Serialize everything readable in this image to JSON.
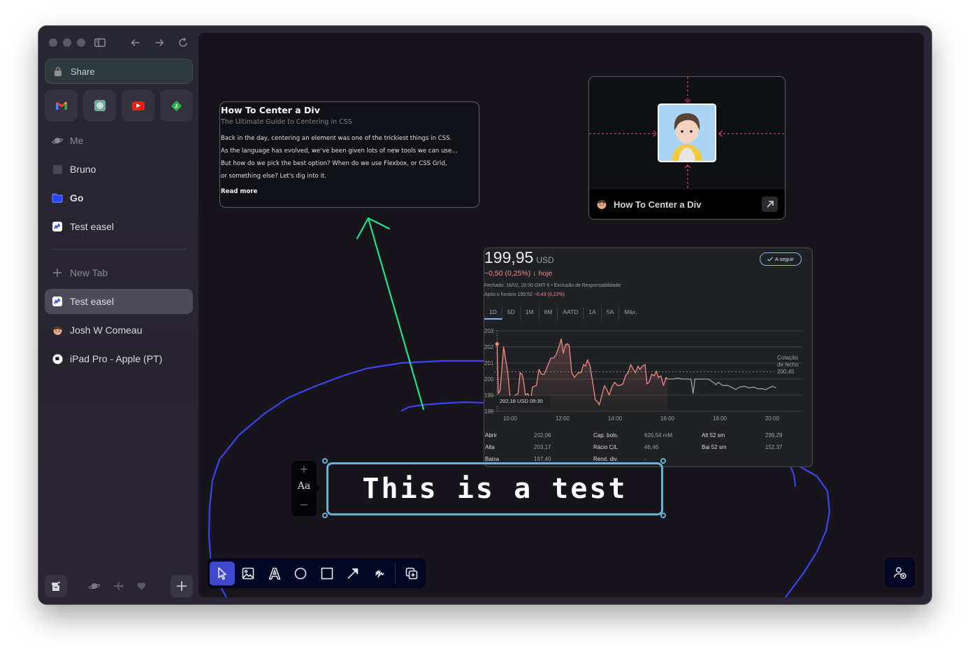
{
  "sidebar": {
    "share_label": "Share",
    "favorites": [
      {
        "name": "gmail-icon"
      },
      {
        "name": "chatgpt-icon"
      },
      {
        "name": "youtube-icon"
      },
      {
        "name": "feedly-icon"
      }
    ],
    "spaces_items": [
      {
        "label": "Me",
        "icon": "planet-icon"
      },
      {
        "label": "Bruno",
        "icon": "square-icon"
      },
      {
        "label": "Go",
        "icon": "folder-icon"
      },
      {
        "label": "Test easel",
        "icon": "easel-icon"
      }
    ],
    "new_tab_label": "New Tab",
    "tabs": [
      {
        "label": "Test easel",
        "icon": "easel-icon",
        "active": true
      },
      {
        "label": "Josh W Comeau",
        "icon": "avatar-icon",
        "active": false
      },
      {
        "label": "iPad Pro - Apple (PT)",
        "icon": "apple-icon",
        "active": false
      }
    ]
  },
  "article_card": {
    "title": "How To Center a Div",
    "subtitle": "The Ultimate Guide to Centering in CSS",
    "body_lines": [
      "Back in the day, centering an element was one of the trickiest things in CSS.",
      "As the language has evolved, we’ve been given lots of new tools we can use…",
      "But how do we pick the best option? When do we use Flexbox, or CSS Grid,",
      "or something else? Let's dig into it."
    ],
    "read_more": "Read more"
  },
  "image_card": {
    "title": "How To Center a Div"
  },
  "stock": {
    "price": "199,95",
    "currency": "USD",
    "change": "−0,50 (0,25%) ↓ hoje",
    "closed_line": "Fechado: 16/02, 20:00 GMT-5 • Exclusão de Responsabilidade",
    "after_hours_label": "Após o horário 199,52",
    "after_hours_change": "−0,43 (0,22%)",
    "follow_label": "A seguir",
    "ranges": [
      "1D",
      "5D",
      "1M",
      "6M",
      "AATD",
      "1A",
      "5A",
      "Máx."
    ],
    "active_range": "1D",
    "stats": [
      {
        "k": "Abrir",
        "v": "202,06"
      },
      {
        "k": "Alta",
        "v": "203,17"
      },
      {
        "k": "Baixa",
        "v": "197,40"
      },
      {
        "k": "Cap. bols.",
        "v": "626,54 mM"
      },
      {
        "k": "Rácio C/L",
        "v": "46,46"
      },
      {
        "k": "Rend. div.",
        "v": "-"
      },
      {
        "k": "Alt 52 sm",
        "v": "299,29"
      },
      {
        "k": "Bai 52 sm",
        "v": "152,37"
      }
    ]
  },
  "chart_data": {
    "type": "line",
    "title": "",
    "xlabel": "",
    "ylabel": "",
    "x_ticks": [
      "10:00",
      "12:00",
      "14:00",
      "16:00",
      "18:00",
      "20:00"
    ],
    "y_ticks": [
      198,
      199,
      200,
      201,
      202,
      203
    ],
    "ylim": [
      198,
      203
    ],
    "xlim_hours": [
      9.5,
      20.5
    ],
    "previous_close": 200.45,
    "previous_close_label": [
      "Cotação",
      "de fecho",
      "200,45"
    ],
    "hover_label": "202,18 USD  09:30",
    "series": [
      {
        "name": "regular",
        "color": "#f28b82",
        "points": [
          [
            9.5,
            202.18
          ],
          [
            9.55,
            199.1
          ],
          [
            9.62,
            199.3
          ],
          [
            9.75,
            202.0
          ],
          [
            9.9,
            200.5
          ],
          [
            10.0,
            198.8
          ],
          [
            10.1,
            198.7
          ],
          [
            10.2,
            199.0
          ],
          [
            10.3,
            199.1
          ],
          [
            10.38,
            200.4
          ],
          [
            10.45,
            200.3
          ],
          [
            10.5,
            200.0
          ],
          [
            10.58,
            199.0
          ],
          [
            10.68,
            199.1
          ],
          [
            10.78,
            198.6
          ],
          [
            10.85,
            199.5
          ],
          [
            11.0,
            199.6
          ],
          [
            11.1,
            200.6
          ],
          [
            11.2,
            200.3
          ],
          [
            11.3,
            200.3
          ],
          [
            11.45,
            200.9
          ],
          [
            11.55,
            201.3
          ],
          [
            11.65,
            201.3
          ],
          [
            11.75,
            201.5
          ],
          [
            11.88,
            202.1
          ],
          [
            11.95,
            202.5
          ],
          [
            12.03,
            201.6
          ],
          [
            12.1,
            202.1
          ],
          [
            12.18,
            202.2
          ],
          [
            12.25,
            202.1
          ],
          [
            12.35,
            200.4
          ],
          [
            12.45,
            200.1
          ],
          [
            12.6,
            200.4
          ],
          [
            12.7,
            200.4
          ],
          [
            12.8,
            200.9
          ],
          [
            12.88,
            200.8
          ],
          [
            12.95,
            201.2
          ],
          [
            13.05,
            200.8
          ],
          [
            13.15,
            199.8
          ],
          [
            13.25,
            198.7
          ],
          [
            13.33,
            198.6
          ],
          [
            13.4,
            198.4
          ],
          [
            13.5,
            199.0
          ],
          [
            13.6,
            199.6
          ],
          [
            13.7,
            199.3
          ],
          [
            13.78,
            199.0
          ],
          [
            13.88,
            199.5
          ],
          [
            13.98,
            199.8
          ],
          [
            14.1,
            199.6
          ],
          [
            14.2,
            199.6
          ],
          [
            14.3,
            199.7
          ],
          [
            14.4,
            200.2
          ],
          [
            14.5,
            200.4
          ],
          [
            14.6,
            200.9
          ],
          [
            14.7,
            200.6
          ],
          [
            14.78,
            200.4
          ],
          [
            14.88,
            200.8
          ],
          [
            14.95,
            200.6
          ],
          [
            15.05,
            200.8
          ],
          [
            15.15,
            200.9
          ],
          [
            15.22,
            199.7
          ],
          [
            15.3,
            199.8
          ],
          [
            15.4,
            200.3
          ],
          [
            15.5,
            200.2
          ],
          [
            15.58,
            200.5
          ],
          [
            15.65,
            200.1
          ],
          [
            15.75,
            200.2
          ],
          [
            15.85,
            199.6
          ],
          [
            15.95,
            200.1
          ],
          [
            16.0,
            200.0
          ]
        ]
      },
      {
        "name": "after-hours",
        "color": "#9aa0a6",
        "points": [
          [
            16.0,
            200.0
          ],
          [
            16.2,
            200.0
          ],
          [
            16.4,
            200.05
          ],
          [
            16.6,
            200.0
          ],
          [
            16.9,
            200.0
          ],
          [
            16.98,
            199.1
          ],
          [
            17.05,
            200.0
          ],
          [
            17.3,
            200.0
          ],
          [
            17.55,
            200.0
          ],
          [
            17.75,
            199.8
          ],
          [
            17.85,
            199.65
          ],
          [
            17.95,
            199.8
          ],
          [
            18.1,
            199.6
          ],
          [
            18.3,
            199.6
          ],
          [
            18.5,
            199.45
          ],
          [
            18.6,
            199.35
          ],
          [
            18.75,
            199.5
          ],
          [
            18.95,
            199.55
          ],
          [
            19.1,
            199.45
          ],
          [
            19.3,
            199.5
          ],
          [
            19.45,
            199.4
          ],
          [
            19.6,
            199.4
          ],
          [
            19.75,
            199.35
          ],
          [
            19.88,
            199.45
          ],
          [
            20.0,
            199.55
          ],
          [
            20.15,
            199.45
          ]
        ]
      }
    ]
  },
  "textbox": {
    "text": "This is a test",
    "font_label": "Aa",
    "increase": "+",
    "decrease": "−"
  },
  "toolbar": {
    "tools": [
      "select",
      "image",
      "text",
      "circle",
      "rectangle",
      "arrow",
      "scribble",
      "add-page"
    ],
    "active": "select"
  },
  "colors": {
    "accent": "#3f48cc",
    "selection": "#62b3d8",
    "drawing_blue": "#3a44ee",
    "drawing_green": "#1ee38a",
    "guide_pink": "#e8386b",
    "stock_down": "#f28b82"
  }
}
